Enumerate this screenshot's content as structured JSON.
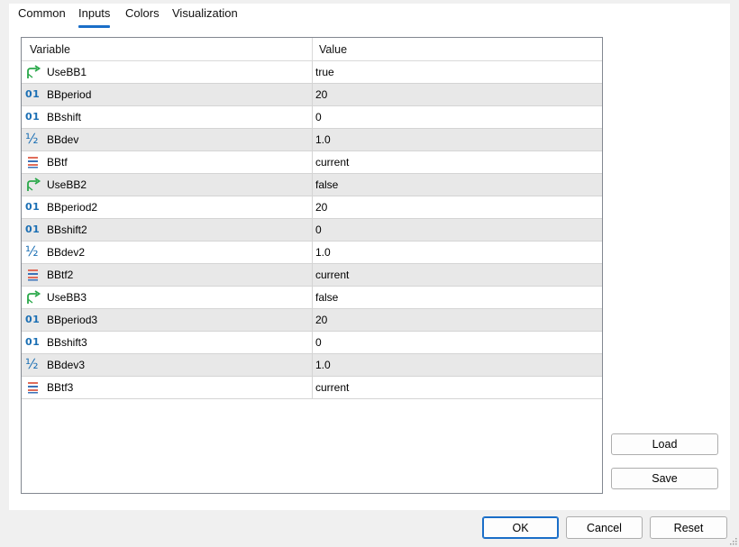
{
  "tabs": [
    {
      "label": "Common"
    },
    {
      "label": "Inputs"
    },
    {
      "label": "Colors"
    },
    {
      "label": "Visualization"
    }
  ],
  "active_tab": "Inputs",
  "grid": {
    "columns": {
      "variable": "Variable",
      "value": "Value"
    },
    "rows": [
      {
        "type": "bool",
        "icon": "bool-arrow-icon",
        "name": "UseBB1",
        "value": "true"
      },
      {
        "type": "int",
        "icon": "integer-icon",
        "name": "BBperiod",
        "value": "20"
      },
      {
        "type": "int",
        "icon": "integer-icon",
        "name": "BBshift",
        "value": "0"
      },
      {
        "type": "double",
        "icon": "fraction-icon",
        "name": "BBdev",
        "value": "1.0"
      },
      {
        "type": "enum",
        "icon": "enum-list-icon",
        "name": "BBtf",
        "value": "current"
      },
      {
        "type": "bool",
        "icon": "bool-arrow-icon",
        "name": "UseBB2",
        "value": "false"
      },
      {
        "type": "int",
        "icon": "integer-icon",
        "name": "BBperiod2",
        "value": "20"
      },
      {
        "type": "int",
        "icon": "integer-icon",
        "name": "BBshift2",
        "value": "0"
      },
      {
        "type": "double",
        "icon": "fraction-icon",
        "name": "BBdev2",
        "value": "1.0"
      },
      {
        "type": "enum",
        "icon": "enum-list-icon",
        "name": "BBtf2",
        "value": "current"
      },
      {
        "type": "bool",
        "icon": "bool-arrow-icon",
        "name": "UseBB3",
        "value": "false"
      },
      {
        "type": "int",
        "icon": "integer-icon",
        "name": "BBperiod3",
        "value": "20"
      },
      {
        "type": "int",
        "icon": "integer-icon",
        "name": "BBshift3",
        "value": "0"
      },
      {
        "type": "double",
        "icon": "fraction-icon",
        "name": "BBdev3",
        "value": "1.0"
      },
      {
        "type": "enum",
        "icon": "enum-list-icon",
        "name": "BBtf3",
        "value": "current"
      }
    ]
  },
  "icon_glyphs": {
    "int": "01",
    "double": "½"
  },
  "buttons": {
    "load": "Load",
    "save": "Save",
    "ok": "OK",
    "cancel": "Cancel",
    "reset": "Reset"
  },
  "colors": {
    "accent": "#1a6ec8",
    "bool_icon": "#2aa84a",
    "int_icon": "#1b6fb4",
    "row_alt": "#e8e8e8"
  }
}
